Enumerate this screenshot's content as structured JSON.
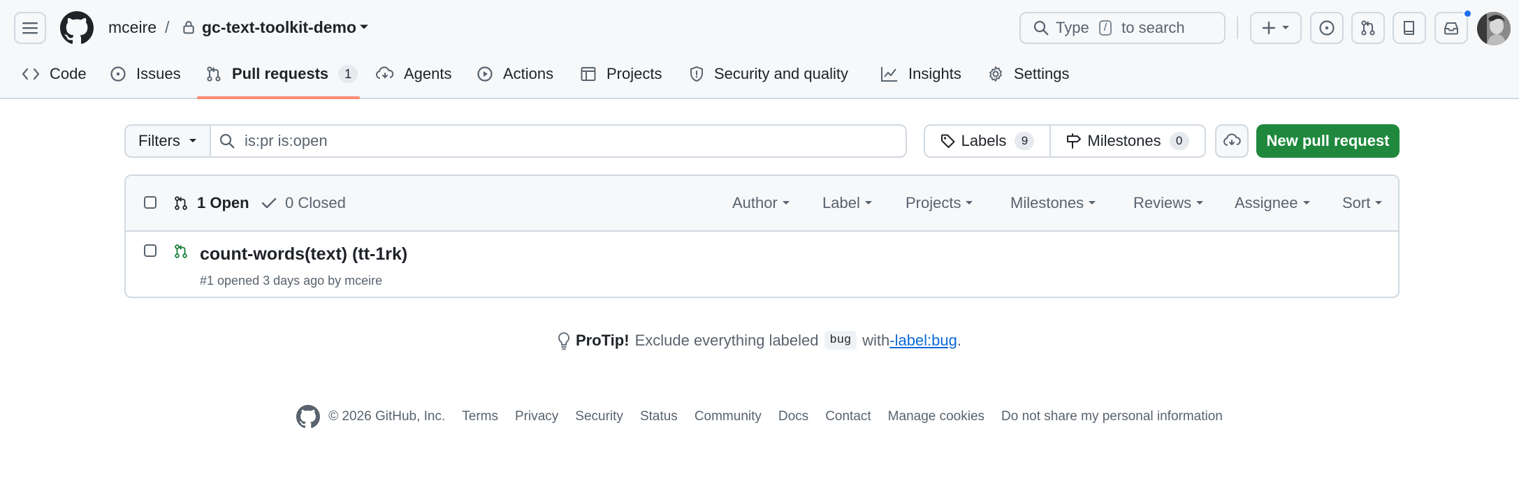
{
  "header": {
    "owner": "mceire",
    "separator": "/",
    "repo": "gc-text-toolkit-demo",
    "search_text_pre": "Type",
    "search_key": "/",
    "search_text_post": "to search"
  },
  "nav": {
    "tabs": [
      {
        "label": "Code",
        "icon": "code-icon"
      },
      {
        "label": "Issues",
        "icon": "issue-opened-icon"
      },
      {
        "label": "Pull requests",
        "icon": "git-pull-request-icon",
        "count": "1",
        "active": true
      },
      {
        "label": "Agents",
        "icon": "agent-icon"
      },
      {
        "label": "Actions",
        "icon": "play-icon"
      },
      {
        "label": "Projects",
        "icon": "table-icon"
      },
      {
        "label": "Security and quality",
        "icon": "shield-icon"
      },
      {
        "label": "Insights",
        "icon": "graph-icon"
      },
      {
        "label": "Settings",
        "icon": "gear-icon"
      }
    ]
  },
  "subnav": {
    "filters_label": "Filters",
    "filter_value": "is:pr is:open",
    "labels_label": "Labels",
    "labels_count": "9",
    "milestones_label": "Milestones",
    "milestones_count": "0",
    "new_pr_label": "New pull request"
  },
  "list": {
    "open_label": "1 Open",
    "closed_label": "0 Closed",
    "filters": [
      "Author",
      "Label",
      "Projects",
      "Milestones",
      "Reviews",
      "Assignee",
      "Sort"
    ],
    "items": [
      {
        "title": "count-words(text) (tt-1rk)",
        "meta": "#1 opened 3 days ago by mceire"
      }
    ]
  },
  "protip": {
    "label": "ProTip!",
    "text_pre": "Exclude everything labeled",
    "code": "bug",
    "text_mid": "with",
    "link": "-label:bug",
    "text_post": "."
  },
  "footer": {
    "copyright": "© 2026 GitHub, Inc.",
    "links": [
      "Terms",
      "Privacy",
      "Security",
      "Status",
      "Community",
      "Docs",
      "Contact",
      "Manage cookies",
      "Do not share my personal information"
    ]
  },
  "colors": {
    "accent_green": "#1f883d",
    "underline": "#fd8c73",
    "link": "#0969da",
    "notification": "#1f6feb"
  }
}
